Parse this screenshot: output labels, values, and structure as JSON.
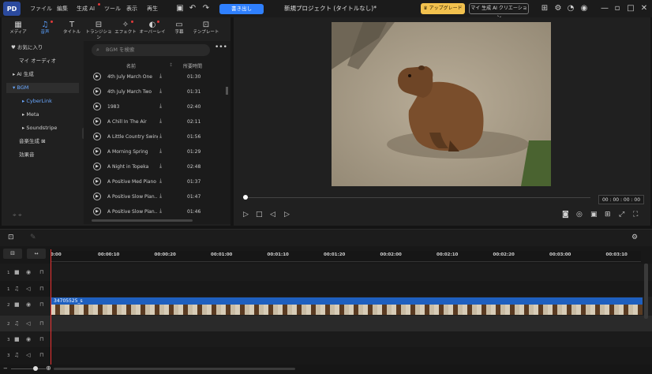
{
  "menu": {
    "file": "ファイル",
    "edit": "編集",
    "ai": "生成 AI",
    "tools": "ツール",
    "view": "表示",
    "playback": "再生"
  },
  "toolbar": {
    "export": "書き出し",
    "title": "新規プロジェクト (タイトルなし)*",
    "upgrade": "アップグレード",
    "ai_credits": "マイ 生成 AI クリエーション"
  },
  "tabs": [
    "メディア",
    "音声",
    "タイトル",
    "トランジション",
    "エフェクト",
    "オーバーレイ",
    "字幕",
    "テンプレート"
  ],
  "sidebar": {
    "favorites": "お気に入り",
    "my_audio": "マイ オーディオ",
    "ai_gen": "AI 生成",
    "bgm": "BGM",
    "cyberlink": "CyberLink",
    "meta": "Meta",
    "soundstripe": "Soundstripe",
    "music_gen": "音楽生成",
    "sfx": "効果音"
  },
  "list": {
    "search_placeholder": "BGM を検索",
    "col_name": "名前",
    "col_duration": "所要時間",
    "items": [
      {
        "name": "4th July March One",
        "dur": "01:30"
      },
      {
        "name": "4th July March Two",
        "dur": "01:31"
      },
      {
        "name": "1983",
        "dur": "02:40"
      },
      {
        "name": "A Chill In The Air",
        "dur": "02:11"
      },
      {
        "name": "A Little Country Swing",
        "dur": "01:56"
      },
      {
        "name": "A Morning Spring",
        "dur": "01:29"
      },
      {
        "name": "A Night in Topeka",
        "dur": "02:48"
      },
      {
        "name": "A Positive Med Piano 2",
        "dur": "01:37"
      },
      {
        "name": "A Positive Slow Pian...",
        "dur": "01:47"
      },
      {
        "name": "A Positive Slow Pian...",
        "dur": "01:46"
      }
    ]
  },
  "preview": {
    "timecode": "00 : 00 : 00 : 00"
  },
  "timeline": {
    "ticks": [
      "0:00",
      "00:00:10",
      "00:00:20",
      "00:01:00",
      "00:01:10",
      "00:01:20",
      "00:02:00",
      "00:02:10",
      "00:02:20",
      "00:03:00",
      "00:03:10"
    ],
    "tracks": [
      "1",
      "1",
      "2",
      "2",
      "3",
      "3"
    ],
    "clip_name": "34705525_s"
  }
}
